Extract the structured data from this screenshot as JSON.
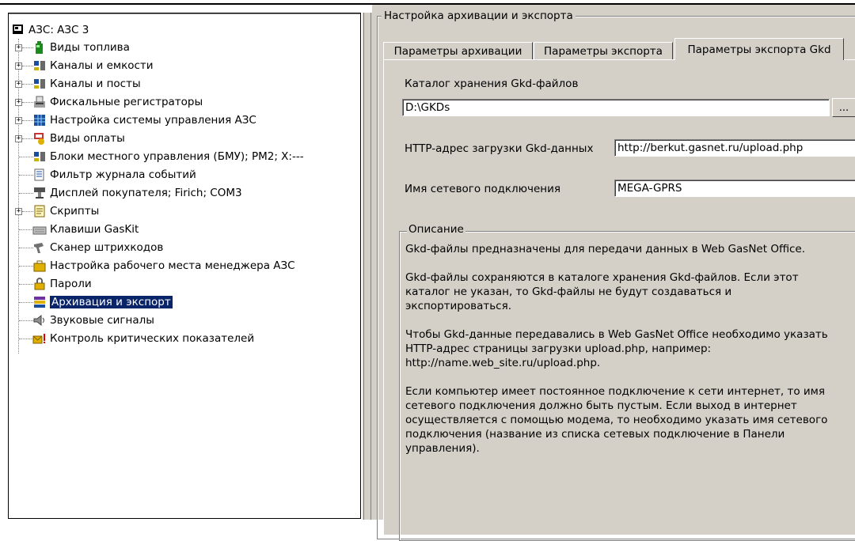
{
  "tree": {
    "root": "АЗС: АЗС 3",
    "items": [
      {
        "label": "Виды топлива",
        "icon": "fuel-icon"
      },
      {
        "label": "Каналы и емкости",
        "icon": "channels-icon"
      },
      {
        "label": "Каналы и посты",
        "icon": "channels-icon"
      },
      {
        "label": "Фискальные регистраторы",
        "icon": "register-icon"
      },
      {
        "label": "Настройка системы управления АЗС",
        "icon": "grid-icon"
      },
      {
        "label": "Виды оплаты",
        "icon": "payment-icon"
      },
      {
        "label": "Блоки местного управления (БМУ);  PM2;  X:---",
        "icon": "channels-icon"
      },
      {
        "label": "Фильтр журнала событий",
        "icon": "filter-icon"
      },
      {
        "label": "Дисплей покупателя; Firich;  COM3",
        "icon": "display-icon"
      },
      {
        "label": "Скрипты",
        "icon": "script-icon"
      },
      {
        "label": "Клавиши GasKit",
        "icon": "keyboard-icon"
      },
      {
        "label": "Сканер штрихкодов",
        "icon": "scanner-icon"
      },
      {
        "label": "Настройка рабочего места менеджера АЗС",
        "icon": "briefcase-icon"
      },
      {
        "label": "Пароли",
        "icon": "lock-icon"
      },
      {
        "label": "Архивация и экспорт",
        "icon": "archive-icon"
      },
      {
        "label": "Звуковые сигналы",
        "icon": "speaker-icon"
      },
      {
        "label": "Контроль критических показателей",
        "icon": "alert-icon"
      }
    ]
  },
  "settings": {
    "group_title": "Настройка архивации и экспорта",
    "tabs": [
      "Параметры архивации",
      "Параметры экспорта",
      "Параметры экспорта Gkd"
    ],
    "catalog_label": "Каталог хранения Gkd-файлов",
    "catalog_value": "D:\\GKDs",
    "browse_label": "...",
    "http_label": "HTTP-адрес загрузки Gkd-данных",
    "http_value": "http://berkut.gasnet.ru/upload.php",
    "conn_label": "Имя сетевого подключения",
    "conn_value": "MEGA-GPRS",
    "desc_title": "Описание",
    "desc": [
      "Gkd-файлы предназначены для передачи данных в Web GasNet Office.",
      "Gkd-файлы сохраняются в каталоге хранения Gkd-файлов. Если этот каталог не указан, то Gkd-файлы не будут создаваться и экспортироваться.",
      "Чтобы Gkd-данные передавались в Web GasNet Office необходимо указать HTTP-адрес страницы загрузки upload.php, например: http://name.web_site.ru/upload.php.",
      "Если компьютер имеет постоянное подключение к сети интернет, то имя сетевого подключения должно быть пустым. Если выход в интернет осуществляется с помощью модема, то необходимо указать имя сетевого подключения (название из списка сетевых подключение в Панели управления)."
    ]
  }
}
